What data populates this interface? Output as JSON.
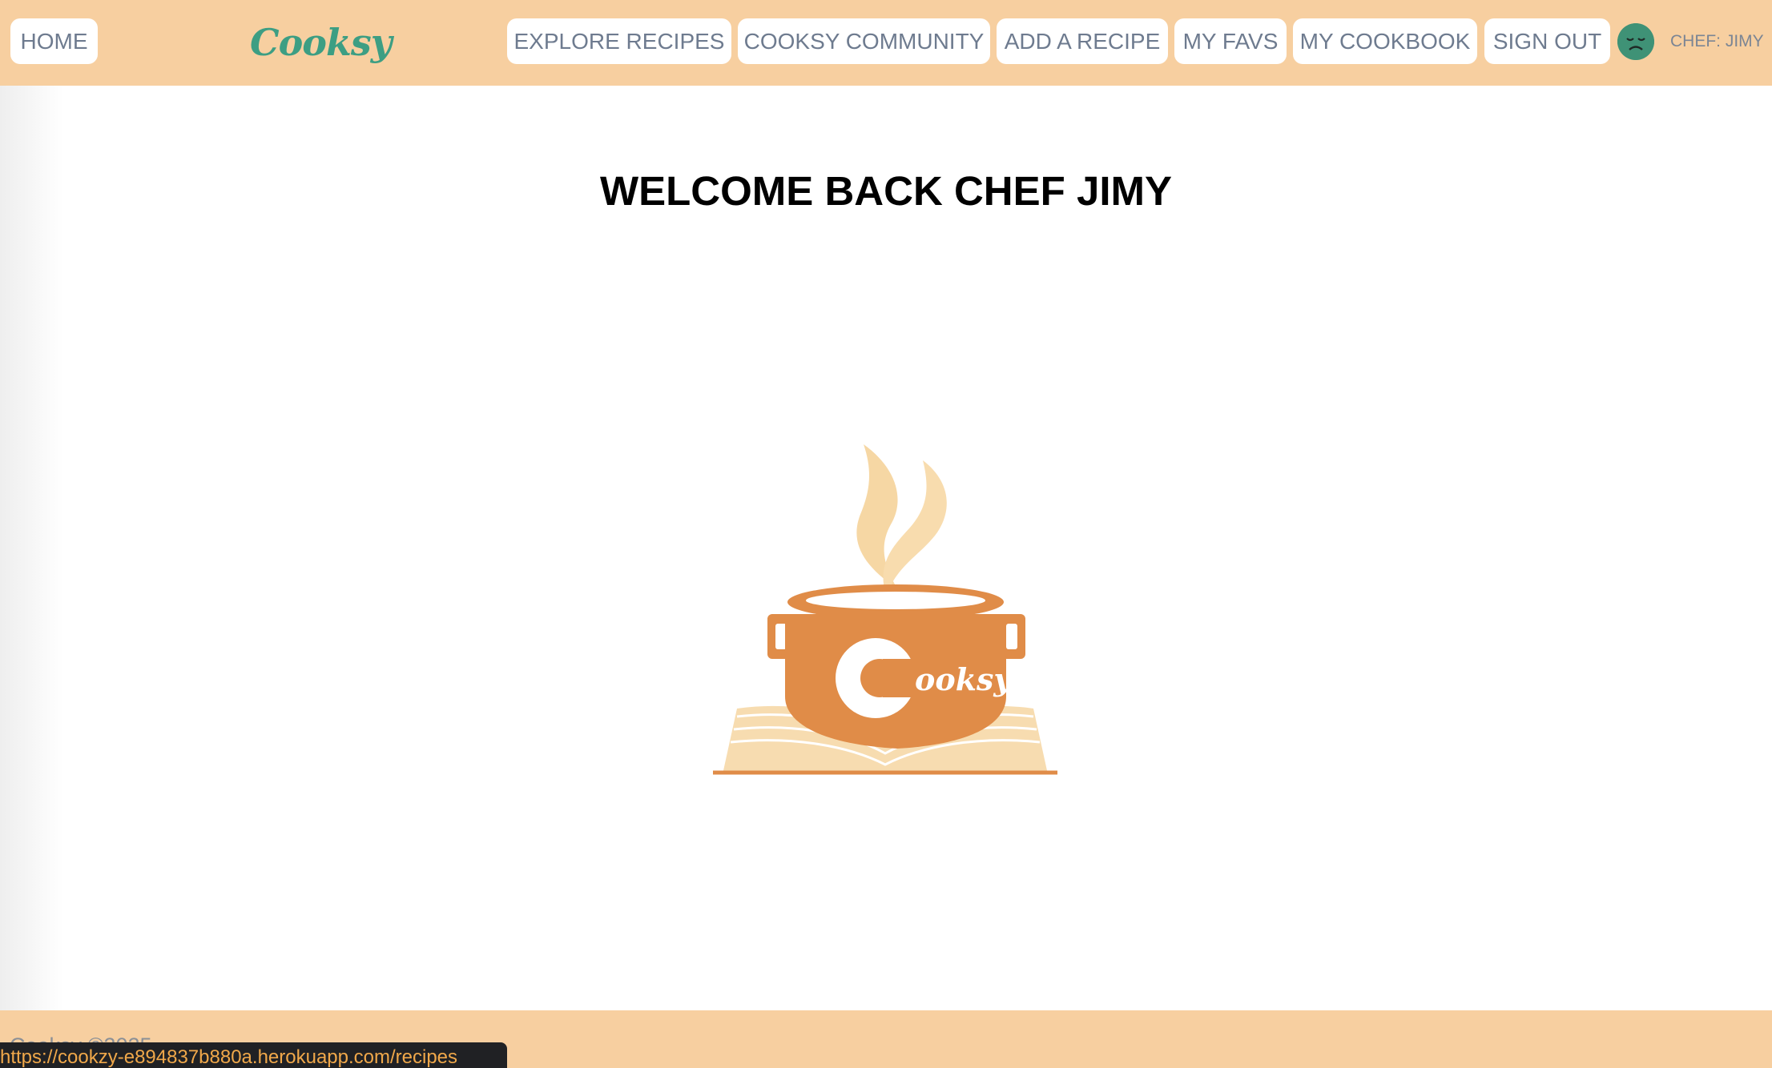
{
  "nav": {
    "home_label": "HOME",
    "brand": "Cooksy",
    "items": [
      {
        "label": "EXPLORE RECIPES"
      },
      {
        "label": "COOKSY COMMUNITY"
      },
      {
        "label": "ADD A RECIPE"
      },
      {
        "label": "MY FAVS"
      },
      {
        "label": "MY COOKBOOK"
      },
      {
        "label": "SIGN OUT"
      }
    ],
    "avatar_icon": "sad-face-icon",
    "user_label": "CHEF: JIMY"
  },
  "main": {
    "welcome": "WELCOME BACK CHEF JIMY",
    "logo_text": "ooksy",
    "logo_letter": "C"
  },
  "footer": {
    "copyright": "Cooksy ©2025"
  },
  "status_bar": {
    "url": "https://cookzy-e894837b880a.herokuapp.com/recipes"
  },
  "colors": {
    "nav_bg": "#f7cfa0",
    "brand_green": "#3d9e83",
    "pot_orange": "#e08c48",
    "steam": "#f6d7a4",
    "book": "#f7dcb0"
  }
}
